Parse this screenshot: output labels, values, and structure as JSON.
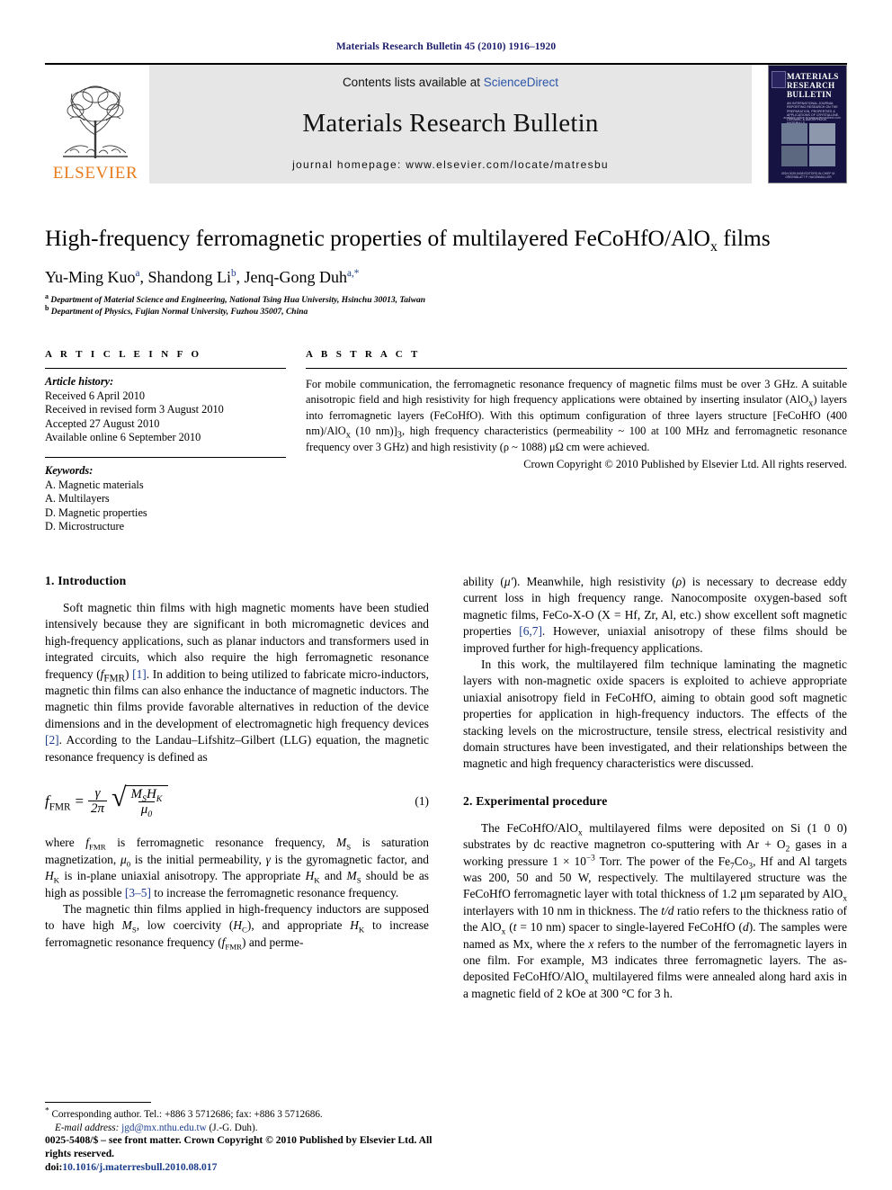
{
  "running_head": "Materials Research Bulletin 45 (2010) 1916–1920",
  "masthead": {
    "publisher_name": "ELSEVIER",
    "contents_prefix": "Contents lists available at ",
    "contents_link": "ScienceDirect",
    "journal_name": "Materials Research Bulletin",
    "homepage": "journal homepage: www.elsevier.com/locate/matresbu",
    "cover": {
      "title_line1": "MATERIALS",
      "title_line2": "RESEARCH",
      "title_line3": "BULLETIN",
      "subtitle": "AN INTERNATIONAL JOURNAL REPORTING RESEARCH ON THE PREPARATION, PROPERTIES & APPLICATIONS OF CRYSTALLINE, CERAMIC & AMORPHOUS MATERIALS",
      "mid_caption": "available online at www.sciencedirect.com",
      "foot_caption": "ISSN 0025-5408   EDITORS-IN-CHIEF  M. GREENBLATT  P. HAGENMULLER"
    }
  },
  "article": {
    "title_main": "High-frequency ferromagnetic properties of multilayered FeCoHfO/AlO",
    "title_sub": "x",
    "title_tail": " films",
    "authors": [
      {
        "name": "Yu-Ming Kuo",
        "mark": "a"
      },
      {
        "name": "Shandong Li",
        "mark": "b"
      },
      {
        "name": "Jenq-Gong Duh",
        "mark": "a,*"
      }
    ],
    "affiliations": [
      {
        "mark": "a",
        "text": "Department of Material Science and Engineering, National Tsing Hua University, Hsinchu 30013, Taiwan"
      },
      {
        "mark": "b",
        "text": "Department of Physics, Fujian Normal University, Fuzhou 35007, China"
      }
    ]
  },
  "info": {
    "heading": "A R T I C L E  I N F O",
    "history_label": "Article history:",
    "history": [
      "Received 6 April 2010",
      "Received in revised form 3 August 2010",
      "Accepted 27 August 2010",
      "Available online 6 September 2010"
    ],
    "keywords_label": "Keywords:",
    "keywords": [
      "A. Magnetic materials",
      "A. Multilayers",
      "D. Magnetic properties",
      "D. Microstructure"
    ]
  },
  "abstract": {
    "heading": "A B S T R A C T",
    "text_part1": "For mobile communication, the ferromagnetic resonance frequency of magnetic films must be over 3 GHz. A suitable anisotropic field and high resistivity for high frequency applications were obtained by inserting insulator (AlO",
    "text_part2": ") layers into ferromagnetic layers (FeCoHfO). With this optimum configuration of three layers structure [FeCoHfO (400 nm)/AlO",
    "text_part3": " (10 nm)]",
    "text_part4": ", high frequency characteristics (permeability ~ 100 at 100 MHz and ferromagnetic resonance frequency over 3 GHz) and high resistivity (ρ ~ 1088) μΩ cm were achieved.",
    "sub_x": "x",
    "sub_3": "3",
    "copyright": "Crown Copyright © 2010 Published by Elsevier Ltd. All rights reserved."
  },
  "sections": {
    "intro_heading": "1. Introduction",
    "intro_p1_a": "Soft magnetic thin films with high magnetic moments have been studied intensively because they are significant in both micromagnetic devices and high-frequency applications, such as planar inductors and transformers used in integrated circuits, which also require the high ferromagnetic resonance frequency (",
    "intro_p1_fmr": "f",
    "intro_p1_fmr_sub": "FMR",
    "intro_p1_b": ") ",
    "intro_ref1": "[1]",
    "intro_p1_c": ". In addition to being utilized to fabricate micro-inductors, magnetic thin films can also enhance the inductance of magnetic inductors. The magnetic thin films provide favorable alternatives in reduction of the device dimensions and in the development of electromagnetic high frequency devices ",
    "intro_ref2": "[2]",
    "intro_p1_d": ". According to the Landau–Lifshitz–Gilbert (LLG) equation, the magnetic resonance frequency is defined as",
    "equation": {
      "lhs": "f",
      "lhs_sub": "FMR",
      "eq": "=",
      "frac_num": "γ",
      "frac_den": "2π",
      "radical_num": "M",
      "radical_num_sub": "S",
      "radical_num2": "H",
      "radical_num2_sub": "K",
      "radical_den": "μ",
      "radical_den_sub": "0",
      "number": "(1)"
    },
    "intro_p2_a": "where ",
    "intro_p2_b": " is ferromagnetic resonance frequency, ",
    "intro_p2_c": " is saturation magnetization, ",
    "intro_p2_d": " is the initial permeability, ",
    "intro_p2_e": " is the gyromagnetic factor, and ",
    "intro_p2_f": " is in-plane uniaxial anisotropy. The appropriate ",
    "intro_p2_g": " and ",
    "intro_p2_h": " should be as high as possible ",
    "intro_ref35": "[3–5]",
    "intro_p2_i": " to increase the ferromagnetic resonance frequency.",
    "intro_p3_a": "The magnetic thin films applied in high-frequency inductors are supposed to have high ",
    "intro_p3_b": ", low coercivity (",
    "intro_p3_c": "), and appropriate ",
    "intro_p3_d": " to increase ferromagnetic resonance frequency (",
    "intro_p3_e": ") and perme-",
    "right_p1_a": "ability (",
    "right_p1_mu": "μ′",
    "right_p1_b": "). Meanwhile, high resistivity (",
    "right_p1_rho": "ρ",
    "right_p1_c": ") is necessary to decrease eddy current loss in high frequency range. Nanocomposite oxygen-based soft magnetic films, FeCo-X-O (X = Hf, Zr, Al, etc.) show excellent soft magnetic properties ",
    "right_ref67": "[6,7]",
    "right_p1_d": ". However, uniaxial anisotropy of these films should be improved further for high-frequency applications.",
    "right_p2": "In this work, the multilayered film technique laminating the magnetic layers with non-magnetic oxide spacers is exploited to achieve appropriate uniaxial anisotropy field in FeCoHfO, aiming to obtain good soft magnetic properties for application in high-frequency inductors. The effects of the stacking levels on the microstructure, tensile stress, electrical resistivity and domain structures have been investigated, and their relationships between the magnetic and high frequency characteristics were discussed.",
    "exp_heading": "2. Experimental procedure",
    "exp_p1_a": "The FeCoHfO/AlO",
    "exp_p1_b": " multilayered films were deposited on Si (1 0 0) substrates by dc reactive magnetron co-sputtering with Ar + O",
    "exp_p1_c": " gases in a working pressure 1 × 10",
    "exp_p1_exp": "−3",
    "exp_p1_d": " Torr. The power of the Fe",
    "exp_p1_e": "Co",
    "exp_p1_f": ", Hf and Al targets was 200, 50 and 50 W, respectively. The multilayered structure was the FeCoHfO ferromagnetic layer with total thickness of 1.2 μm separated by AlO",
    "exp_p1_g": " interlayers with 10 nm in thickness. The ",
    "exp_p1_td": "t/d",
    "exp_p1_h": " ratio refers to the thickness ratio of the AlO",
    "exp_p1_i": " (",
    "exp_p1_t": "t",
    "exp_p1_j": " = 10 nm) spacer to single-layered FeCoHfO (",
    "exp_p1_d2": "d",
    "exp_p1_k": "). The samples were named as Mx, where the ",
    "exp_p1_x": "x",
    "exp_p1_l": " refers to the number of the ferromagnetic layers in one film. For example, M3 indicates three ferromagnetic layers. The as-deposited FeCoHfO/AlO",
    "exp_p1_m": " multilayered films were annealed along hard axis in a magnetic field of 2 kOe at 300 °C for 3 h."
  },
  "footnote": {
    "star": "*",
    "corresponding": " Corresponding author. Tel.: +886 3 5712686; fax: +886 3 5712686.",
    "email_label": "E-mail address:",
    "email": "jgd@mx.nthu.edu.tw",
    "email_owner": " (J.-G. Duh)."
  },
  "copyright_footer": {
    "line1": "0025-5408/$ – see front matter. Crown Copyright © 2010 Published by Elsevier Ltd. All rights reserved.",
    "doi_label": "doi:",
    "doi": "10.1016/j.materresbull.2010.08.017"
  },
  "colors": {
    "running_head": "#1b1c6b",
    "link": "#1b3c8b",
    "sciencedirect": "#2b55a8",
    "elsevier_orange": "#E87C1E",
    "band_gray": "#e6e6e6",
    "cover_navy": "#161242"
  }
}
